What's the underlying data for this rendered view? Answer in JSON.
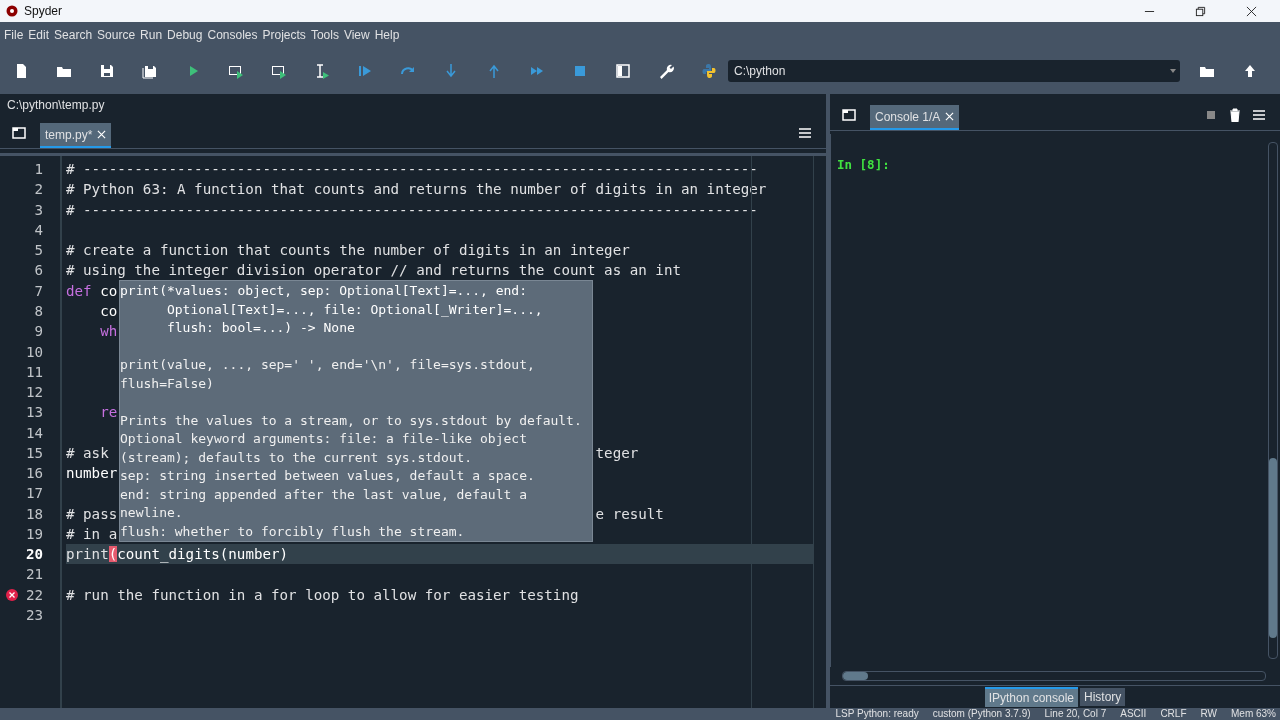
{
  "window": {
    "title": "Spyder"
  },
  "menu": [
    "File",
    "Edit",
    "Search",
    "Source",
    "Run",
    "Debug",
    "Consoles",
    "Projects",
    "Tools",
    "View",
    "Help"
  ],
  "working_directory": {
    "value": "C:\\python"
  },
  "editor": {
    "path": "C:\\python\\temp.py",
    "tabs": [
      {
        "label": "temp.py*",
        "selected": true
      }
    ],
    "lines": [
      {
        "number": "1",
        "current": false,
        "error": false,
        "segments": [
          {
            "kind": "comment",
            "text": "# -------------------------------------------------------------------------------"
          }
        ]
      },
      {
        "number": "2",
        "current": false,
        "error": false,
        "segments": [
          {
            "kind": "comment",
            "text": "# Python 63: A function that counts and returns the number of digits in an integer"
          }
        ]
      },
      {
        "number": "3",
        "current": false,
        "error": false,
        "segments": [
          {
            "kind": "comment",
            "text": "# -------------------------------------------------------------------------------"
          }
        ]
      },
      {
        "number": "4",
        "current": false,
        "error": false
      },
      {
        "number": "5",
        "current": false,
        "error": false,
        "segments": [
          {
            "kind": "comment",
            "text": "# create a function that counts the number of digits in an integer"
          }
        ]
      },
      {
        "number": "6",
        "current": false,
        "error": false,
        "segments": [
          {
            "kind": "comment",
            "text": "# using the integer division operator // and returns the count as an int"
          }
        ]
      },
      {
        "number": "7",
        "current": false,
        "error": false,
        "segments": [
          {
            "kind": "keyword",
            "text": "def"
          },
          {
            "kind": "plain",
            "text": " co"
          }
        ]
      },
      {
        "number": "8",
        "current": false,
        "error": false,
        "segments": [
          {
            "kind": "plain",
            "text": "    co"
          }
        ]
      },
      {
        "number": "9",
        "current": false,
        "error": false,
        "segments": [
          {
            "kind": "keyword",
            "text": "    wh"
          }
        ]
      },
      {
        "number": "10",
        "current": false,
        "error": false
      },
      {
        "number": "11",
        "current": false,
        "error": false
      },
      {
        "number": "12",
        "current": false,
        "error": false
      },
      {
        "number": "13",
        "current": false,
        "error": false,
        "segments": [
          {
            "kind": "keyword",
            "text": "    re"
          }
        ]
      },
      {
        "number": "14",
        "current": false,
        "error": false
      },
      {
        "number": "15",
        "current": false,
        "error": false,
        "segments": [
          {
            "kind": "comment",
            "text": "# ask"
          }
        ],
        "tail": "teger"
      },
      {
        "number": "16",
        "current": false,
        "error": false,
        "segments": [
          {
            "kind": "plain",
            "text": "number"
          }
        ]
      },
      {
        "number": "17",
        "current": false,
        "error": false
      },
      {
        "number": "18",
        "current": false,
        "error": false,
        "segments": [
          {
            "kind": "comment",
            "text": "# pass"
          }
        ],
        "tail": "e result"
      },
      {
        "number": "19",
        "current": false,
        "error": false,
        "segments": [
          {
            "kind": "comment",
            "text": "# in a"
          }
        ]
      },
      {
        "number": "20",
        "current": true,
        "error": false,
        "segments": [
          {
            "kind": "builtin",
            "text": "print"
          },
          {
            "kind": "unmatched",
            "text": "("
          },
          {
            "kind": "plain",
            "text": "count_digits(number)"
          }
        ]
      },
      {
        "number": "21",
        "current": false,
        "error": false
      },
      {
        "number": "22",
        "current": false,
        "error": true,
        "segments": [
          {
            "kind": "comment",
            "text": "# run the function in a for loop to allow for easier testing"
          }
        ]
      },
      {
        "number": "23",
        "current": false,
        "error": false
      }
    ],
    "tooltip": {
      "signature": [
        "print(*values: object, sep: Optional[Text]=..., end:",
        "      Optional[Text]=..., file: Optional[_Writer]=...,",
        "      flush: bool=...) -> None"
      ],
      "usage": [
        "print(value, ..., sep=' ', end='\\n', file=sys.stdout,",
        "flush=False)"
      ],
      "doc": [
        "Prints the values to a stream, or to sys.stdout by default.",
        "Optional keyword arguments: file: a file-like object",
        "(stream); defaults to the current sys.stdout.",
        "sep: string inserted between values, default a space.",
        "end: string appended after the last value, default a",
        "newline.",
        "flush: whether to forcibly flush the stream."
      ]
    }
  },
  "console": {
    "tabs": [
      {
        "label": "Console 1/A",
        "selected": true
      }
    ],
    "prompt": "In [8]:",
    "bottom_tabs": [
      {
        "label": "IPython console",
        "selected": true
      },
      {
        "label": "History",
        "selected": false
      }
    ]
  },
  "status_bar": [
    "LSP Python: ready",
    "custom (Python 3.7.9)",
    "Line 20, Col 7",
    "ASCII",
    "CRLF",
    "RW",
    "Mem 63%"
  ]
}
